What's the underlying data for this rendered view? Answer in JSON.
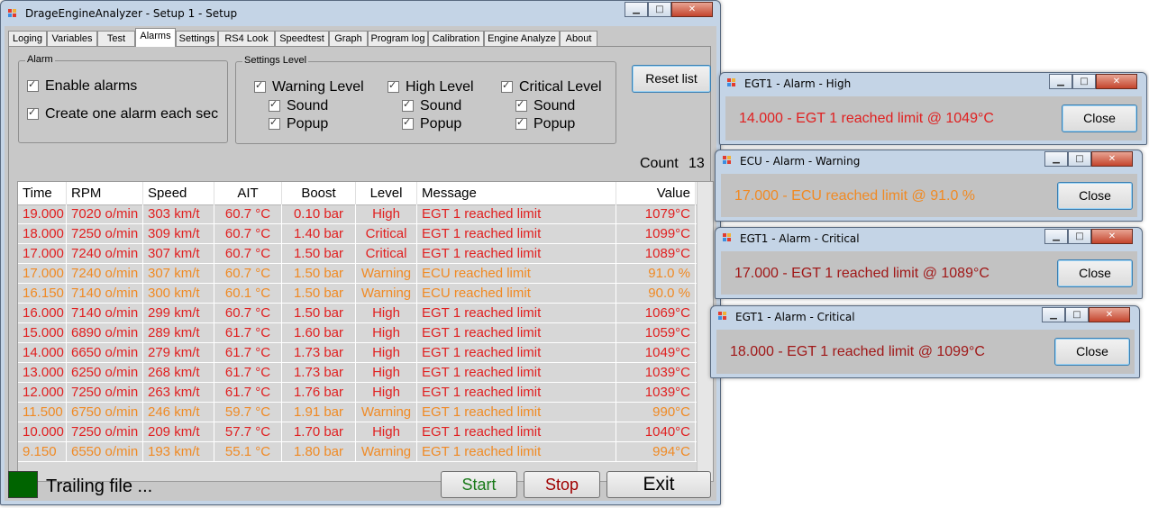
{
  "main_window": {
    "title": "DrageEngineAnalyzer - Setup 1 - Setup",
    "controls": {
      "minimize": "▁",
      "maximize": "□",
      "close": "✕"
    },
    "tabs": [
      "Loging",
      "Variables",
      "Test",
      "Alarms",
      "Settings",
      "RS4 Look",
      "Speedtest",
      "Graph",
      "Program log",
      "Calibration",
      "Engine Analyze",
      "About"
    ],
    "active_tab": "Alarms",
    "alarm_group": {
      "label": "Alarm",
      "enable_alarms": "Enable alarms",
      "create_one_each_sec": "Create one alarm each sec"
    },
    "settings_level": {
      "label": "Settings Level",
      "warning_level": "Warning Level",
      "high_level": "High Level",
      "critical_level": "Critical Level",
      "sound": "Sound",
      "popup": "Popup"
    },
    "reset_button": "Reset list",
    "count_label": "Count",
    "count_value": "13",
    "grid": {
      "columns": [
        "Time",
        "RPM",
        "Speed",
        "AIT",
        "Boost",
        "Level",
        "Message",
        "Value"
      ],
      "rows": [
        [
          "19.000",
          "7020 o/min",
          "303 km/t",
          "60.7 °C",
          "0.10 bar",
          "High",
          "EGT 1 reached limit",
          "1079°C"
        ],
        [
          "18.000",
          "7250 o/min",
          "309 km/t",
          "60.7 °C",
          "1.40 bar",
          "Critical",
          "EGT 1 reached limit",
          "1099°C"
        ],
        [
          "17.000",
          "7240 o/min",
          "307 km/t",
          "60.7 °C",
          "1.50 bar",
          "Critical",
          "EGT 1 reached limit",
          "1089°C"
        ],
        [
          "17.000",
          "7240 o/min",
          "307 km/t",
          "60.7 °C",
          "1.50 bar",
          "Warning",
          "ECU reached limit",
          "91.0 %"
        ],
        [
          "16.150",
          "7140 o/min",
          "300 km/t",
          "60.1 °C",
          "1.50 bar",
          "Warning",
          "ECU reached limit",
          "90.0 %"
        ],
        [
          "16.000",
          "7140 o/min",
          "299 km/t",
          "60.7 °C",
          "1.50 bar",
          "High",
          "EGT 1 reached limit",
          "1069°C"
        ],
        [
          "15.000",
          "6890 o/min",
          "289 km/t",
          "61.7 °C",
          "1.60 bar",
          "High",
          "EGT 1 reached limit",
          "1059°C"
        ],
        [
          "14.000",
          "6650 o/min",
          "279 km/t",
          "61.7 °C",
          "1.73 bar",
          "High",
          "EGT 1 reached limit",
          "1049°C"
        ],
        [
          "13.000",
          "6250 o/min",
          "268 km/t",
          "61.7 °C",
          "1.73 bar",
          "High",
          "EGT 1 reached limit",
          "1039°C"
        ],
        [
          "12.000",
          "7250 o/min",
          "263 km/t",
          "61.7 °C",
          "1.76 bar",
          "High",
          "EGT 1 reached limit",
          "1039°C"
        ],
        [
          "11.500",
          "6750 o/min",
          "246 km/t",
          "59.7 °C",
          "1.91 bar",
          "Warning",
          "EGT 1 reached limit",
          "990°C"
        ],
        [
          "10.000",
          "7250 o/min",
          "209 km/t",
          "57.7 °C",
          "1.70 bar",
          "High",
          "EGT 1 reached limit",
          "1040°C"
        ],
        [
          "9.150",
          "6550 o/min",
          "193 km/t",
          "55.1 °C",
          "1.80 bar",
          "Warning",
          "EGT 1 reached limit",
          "994°C"
        ]
      ]
    },
    "status_text": "Trailing file ...",
    "start_button": "Start",
    "stop_button": "Stop",
    "exit_button": "Exit"
  },
  "colors": {
    "critical_high": "#e02020",
    "warning": "#f08a24",
    "led_on": "#006400",
    "start_text": "#1a7a1a",
    "stop_text": "#a00000"
  },
  "popups": [
    {
      "title": "EGT1 - Alarm - High",
      "message": "14.000 - EGT 1 reached limit @ 1049°C",
      "level": "High",
      "close": "Close"
    },
    {
      "title": "ECU - Alarm - Warning",
      "message": "17.000 - ECU reached limit @ 91.0 %",
      "level": "Warning",
      "close": "Close"
    },
    {
      "title": "EGT1 - Alarm - Critical",
      "message": "17.000 - EGT 1 reached limit @ 1089°C",
      "level": "Critical",
      "close": "Close"
    },
    {
      "title": "EGT1 - Alarm - Critical",
      "message": "18.000 - EGT 1 reached limit @ 1099°C",
      "level": "Critical",
      "close": "Close"
    }
  ]
}
